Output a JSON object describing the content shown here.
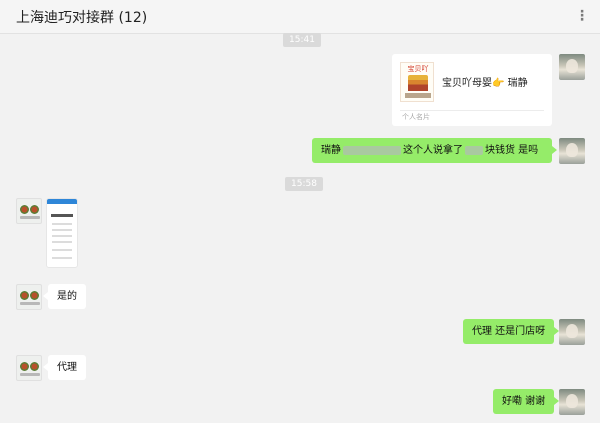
{
  "header": {
    "title": "上海迪巧对接群 (12)",
    "more_icon": "ellipsis-icon"
  },
  "timestamps": [
    "15:41",
    "15:58"
  ],
  "messages": {
    "card": {
      "name": "宝贝吖母婴👉 瑞静",
      "type_label": "个人名片",
      "logo_text": "宝贝吖"
    },
    "m1": {
      "pre": "瑞静",
      "mid": "这个人说拿了",
      "post": "块钱货 是吗"
    },
    "m2": {
      "text": "是的"
    },
    "m3": {
      "text": "代理 还是门店呀"
    },
    "m4": {
      "text": "代理"
    },
    "m5": {
      "text": "好嘞 谢谢"
    }
  },
  "colors": {
    "self_bubble": "#95ec69",
    "other_bubble": "#ffffff",
    "background": "#f2f2f2"
  }
}
